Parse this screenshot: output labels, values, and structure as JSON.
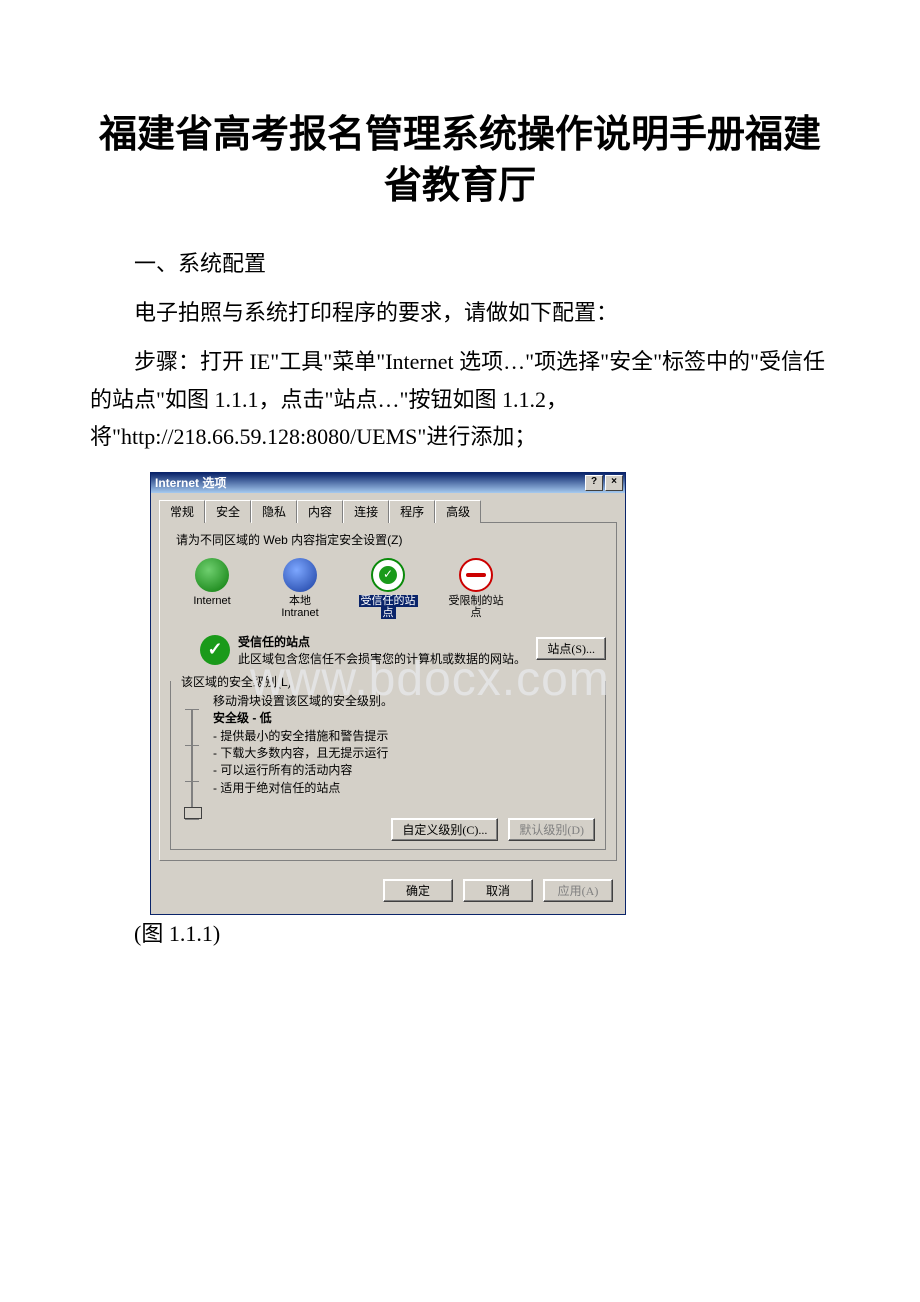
{
  "doc": {
    "title": "福建省高考报名管理系统操作说明手册福建省教育厅",
    "section_heading": "一、系统配置",
    "para1": "电子拍照与系统打印程序的要求，请做如下配置：",
    "para2": "步骤：打开 IE\"工具\"菜单\"Internet 选项…\"项选择\"安全\"标签中的\"受信任的站点\"如图 1.1.1，点击\"站点…\"按钮如图 1.1.2，将\"http://218.66.59.128:8080/UEMS\"进行添加；",
    "figure_caption": "(图 1.1.1)"
  },
  "watermark": "www.bdocx.com",
  "dialog": {
    "title": "Internet 选项",
    "help_btn": "?",
    "close_btn": "×",
    "tabs": [
      "常规",
      "安全",
      "隐私",
      "内容",
      "连接",
      "程序",
      "高级"
    ],
    "active_tab_index": 1,
    "zone_instruction": "请为不同区域的 Web 内容指定安全设置(Z)",
    "zones": [
      {
        "label": "Internet"
      },
      {
        "label_line1": "本地",
        "label_line2": "Intranet"
      },
      {
        "label_line1": "受信任的站",
        "label_line2": "点",
        "selected": true
      },
      {
        "label_line1": "受限制的站",
        "label_line2": "点"
      }
    ],
    "selected_zone_title": "受信任的站点",
    "selected_zone_desc": "此区域包含您信任不会损害您的计算机或数据的网站。",
    "sites_button": "站点(S)...",
    "level_group_title": "该区域的安全级别(L)",
    "level_hint": "移动滑块设置该区域的安全级别。",
    "level_name": "安全级 - 低",
    "level_bullets": [
      "- 提供最小的安全措施和警告提示",
      "- 下载大多数内容，且无提示运行",
      "- 可以运行所有的活动内容",
      "- 适用于绝对信任的站点"
    ],
    "custom_level_btn": "自定义级别(C)...",
    "default_level_btn": "默认级别(D)",
    "ok_btn": "确定",
    "cancel_btn": "取消",
    "apply_btn": "应用(A)"
  }
}
